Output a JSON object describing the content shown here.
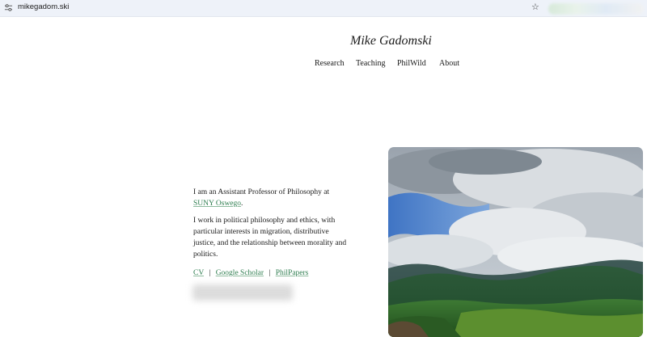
{
  "browser": {
    "url": "mikegadom.ski",
    "site_info_icon": "tune-icon",
    "bookmark_icon": "star-icon"
  },
  "site": {
    "title": "Mike Gadomski",
    "nav": [
      {
        "label": "Research"
      },
      {
        "label": "Teaching"
      },
      {
        "label": "PhilWild"
      },
      {
        "label": "About"
      }
    ]
  },
  "intro": {
    "line1_prefix": "I am an Assistant Professor of Philosophy at",
    "affiliation_link": "SUNY Oswego",
    "line1_suffix": ".",
    "paragraph2": "I work in political philosophy and ethics, with particular interests in migration, distributive justice, and the relationship between morality and politics."
  },
  "links": {
    "cv": "CV",
    "google_scholar": "Google Scholar",
    "philpapers": "PhilPapers",
    "separator": "|"
  },
  "colors": {
    "link": "#2e7d4f",
    "browser_bar": "#eef2f9",
    "text": "#1a1a1a"
  },
  "image": {
    "subject": "mountain landscape with cloudy sky",
    "icon": "landscape-photo"
  }
}
